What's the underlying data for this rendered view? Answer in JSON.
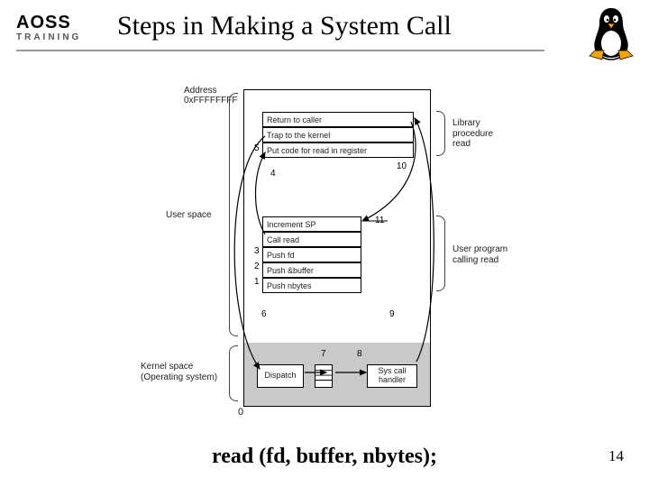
{
  "header": {
    "logo_main": "AOSS",
    "logo_sub": "TRAINING",
    "title": "Steps in Making a System Call"
  },
  "diagram": {
    "address_label_line1": "Address",
    "address_label_line2": "0xFFFFFFFF",
    "user_space_label": "User space",
    "kernel_space_label_line1": "Kernel space",
    "kernel_space_label_line2": "(Operating system)",
    "lib_label_line1": "Library",
    "lib_label_line2": "procedure",
    "lib_label_line3": "read",
    "userprog_label_line1": "User program",
    "userprog_label_line2": "calling read",
    "zero_label": "0",
    "top_rows": {
      "r1": "Return to caller",
      "r2": "Trap to the kernel",
      "r3": "Put code for read in register"
    },
    "mid_rows": {
      "r1": "Increment SP",
      "r2": "Call read",
      "r3": "Push fd",
      "r4": "Push &buffer",
      "r5": "Push nbytes"
    },
    "kernel_boxes": {
      "dispatch": "Dispatch",
      "syscall": "Sys call handler"
    },
    "step_labels": {
      "s1": "1",
      "s2": "2",
      "s3": "3",
      "s4": "4",
      "s5": "5",
      "s6": "6",
      "s7": "7",
      "s8": "8",
      "s9": "9",
      "s10": "10",
      "s11": "11"
    }
  },
  "caption": "read (fd, buffer, nbytes);",
  "page_number": "14"
}
